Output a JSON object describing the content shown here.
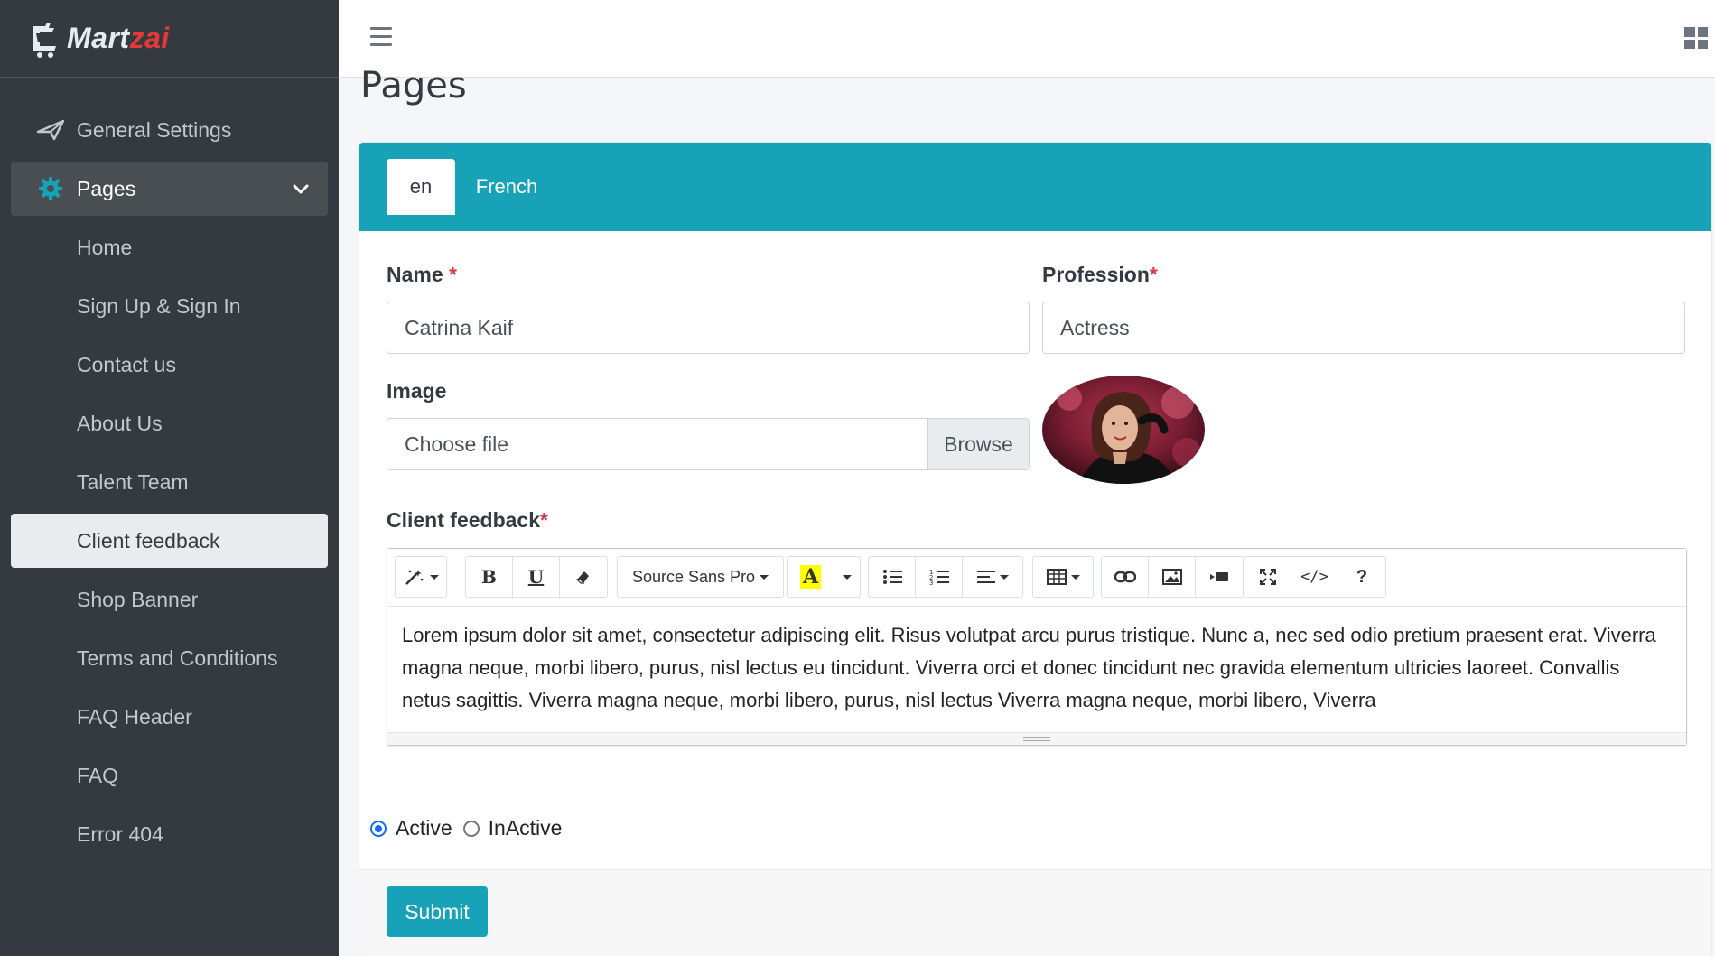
{
  "brand": {
    "name_part1": "Mart",
    "name_part2": "zai"
  },
  "sidebar": {
    "items": [
      {
        "label": "General Settings",
        "icon": "paper-plane-icon"
      },
      {
        "label": "Pages",
        "icon": "gear-icon"
      },
      {
        "label": "Home"
      },
      {
        "label": "Sign Up & Sign In"
      },
      {
        "label": "Contact us"
      },
      {
        "label": "About Us"
      },
      {
        "label": "Talent Team"
      },
      {
        "label": "Client feedback"
      },
      {
        "label": "Shop Banner"
      },
      {
        "label": "Terms and Conditions"
      },
      {
        "label": "FAQ Header"
      },
      {
        "label": "FAQ"
      },
      {
        "label": "Error 404"
      }
    ]
  },
  "page": {
    "title": "Pages"
  },
  "tabs": [
    {
      "label": "en",
      "active": true
    },
    {
      "label": "French",
      "active": false
    }
  ],
  "form": {
    "name_label": "Name",
    "name_value": "Catrina Kaif",
    "profession_label": "Profession",
    "profession_value": "Actress",
    "required_mark": "*",
    "image_label": "Image",
    "file_placeholder": "Choose file",
    "browse_label": "Browse",
    "feedback_label": "Client feedback",
    "font_name": "Source Sans Pro",
    "feedback_text": "Lorem ipsum dolor sit amet, consectetur adipiscing elit. Risus volutpat arcu purus tristique. Nunc a, nec sed odio pretium praesent erat. Viverra magna neque, morbi libero, purus, nisl lectus eu tincidunt. Viverra orci et donec tincidunt nec gravida elementum ultricies laoreet. Convallis netus sagittis. Viverra magna neque, morbi libero, purus, nisl lectus Viverra magna neque, morbi libero, Viverra",
    "status_active": "Active",
    "status_inactive": "InActive",
    "status_selected": "Active",
    "submit_label": "Submit"
  },
  "toolbar": {
    "bold": "B",
    "underline": "U",
    "font_color": "A",
    "help": "?"
  },
  "colors": {
    "accent": "#17a2b8",
    "sidebar": "#343a40",
    "required": "#dc3545"
  }
}
